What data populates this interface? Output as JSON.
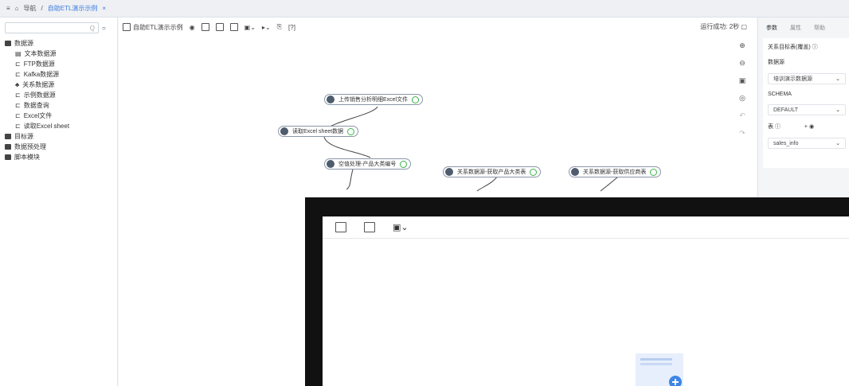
{
  "topbar": {
    "menu_icon": "menu-icon",
    "home_icon": "home-icon",
    "nav_label": "导航",
    "separator": "/",
    "tab_title": "自助ETL演示示例",
    "close": "×"
  },
  "sidebar": {
    "search_placeholder": "Q",
    "tree": [
      {
        "label": "数据源",
        "type": "folder",
        "children": [
          {
            "label": "文本数据源"
          },
          {
            "label": "FTP数据源"
          },
          {
            "label": "Kafka数据源"
          },
          {
            "label": "关系数据源"
          },
          {
            "label": "示例数据源"
          },
          {
            "label": "数据查询"
          },
          {
            "label": "Excel文件"
          },
          {
            "label": "读取Excel sheet"
          }
        ]
      },
      {
        "label": "目标源",
        "type": "folder"
      },
      {
        "label": "数据预处理",
        "type": "folder"
      },
      {
        "label": "脚本模块",
        "type": "folder"
      }
    ]
  },
  "toolbar": {
    "title": "自助ETL演示示例",
    "status": "运行成功: 2秒",
    "help": "[?]"
  },
  "flow_nodes": [
    {
      "label": "上传销售分析明细Excel文件"
    },
    {
      "label": "读取Excel sheet数据"
    },
    {
      "label": "空值处理-产品大类编号"
    },
    {
      "label": "关系数据源-获取产品大类表"
    },
    {
      "label": "关系数据源-获取供应商表"
    }
  ],
  "rightpanel": {
    "tabs": [
      "参数",
      "属性",
      "帮助"
    ],
    "section": "关系目标表(覆盖)",
    "datasource_label": "数据源",
    "datasource_value": "培训演示数据源",
    "schema_label": "SCHEMA",
    "schema_value": "DEFAULT",
    "table_label": "表",
    "table_value": "sales_info"
  },
  "overlay": {
    "icons": [
      "save-icon",
      "save-as-icon",
      "settings-dropdown-icon"
    ]
  }
}
